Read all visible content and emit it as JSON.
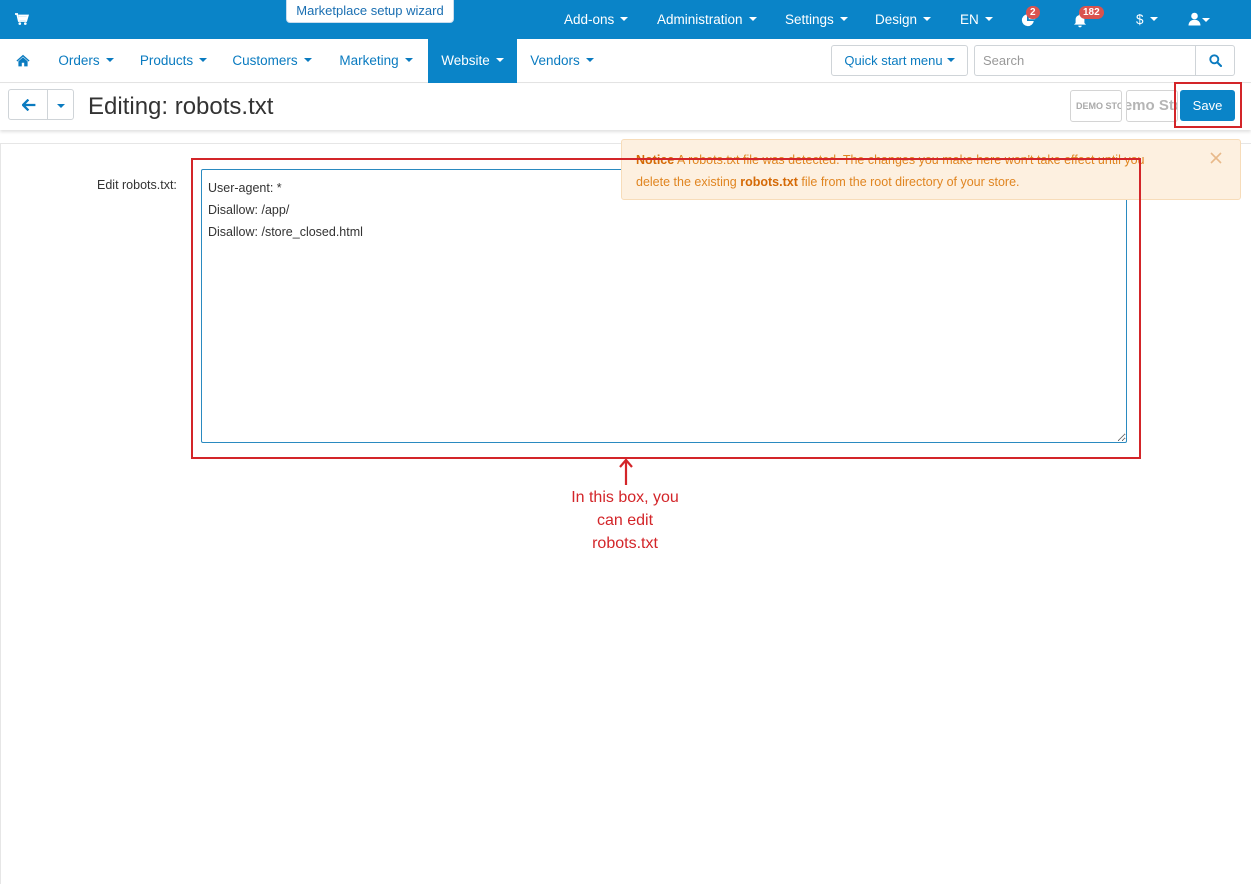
{
  "topbar": {
    "wizard_label": "Marketplace setup wizard",
    "items": [
      {
        "label": "Add-ons"
      },
      {
        "label": "Administration"
      },
      {
        "label": "Settings"
      },
      {
        "label": "Design"
      },
      {
        "label": "EN"
      }
    ],
    "badge_notifications_count": "2",
    "badge_bell_count": "182",
    "currency_label": "$"
  },
  "navbar": {
    "items": [
      {
        "label": "Orders"
      },
      {
        "label": "Products"
      },
      {
        "label": "Customers"
      },
      {
        "label": "Marketing"
      },
      {
        "label": "Website"
      },
      {
        "label": "Vendors"
      }
    ],
    "active_item": "Website",
    "quick_start_label": "Quick start menu",
    "search_placeholder": "Search"
  },
  "titlebar": {
    "title": "Editing: robots.txt",
    "demo_logo_small": "DEMO STORE",
    "demo_logo_large": "Demo Store",
    "save_label": "Save"
  },
  "form": {
    "label": "Edit robots.txt:",
    "content": "User-agent: *\nDisallow: /app/\nDisallow: /store_closed.html\n"
  },
  "notice": {
    "title": "Notice",
    "text_before": "A robots.txt file was detected. The changes you make here won't take effect until you delete the existing",
    "filename": "robots.txt",
    "text_after": "file from the root directory of your store."
  },
  "annotation": {
    "line1": "In this box, you",
    "line2": "can edit",
    "line3": "robots.txt"
  },
  "colors": {
    "primary": "#0a84c8",
    "annotation_red": "#d32529",
    "notice_text": "#e08521",
    "notice_bg": "#fdf0e0"
  }
}
